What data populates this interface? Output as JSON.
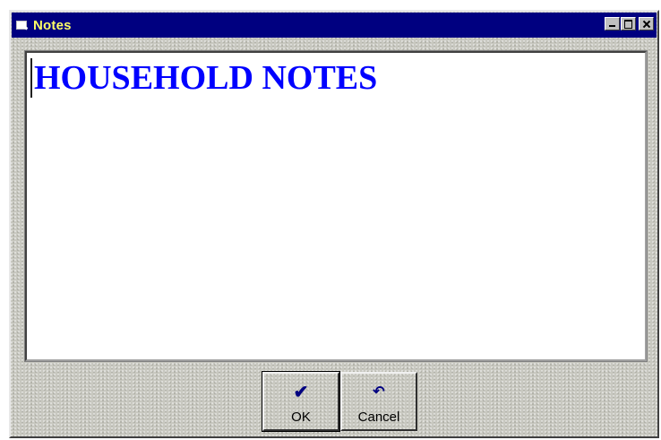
{
  "window": {
    "title": "Notes",
    "title_color": "#ffff66",
    "titlebar_color": "#000080",
    "icon": "notes-app-icon",
    "controls": [
      "minimize-icon",
      "maximize-icon",
      "close-icon"
    ]
  },
  "editor": {
    "text": "HOUSEHOLD NOTES",
    "text_color": "#0000ff",
    "background": "#ffffff"
  },
  "buttons": {
    "ok": {
      "label": "OK",
      "icon": "checkmark-icon",
      "glyph": "✔"
    },
    "cancel": {
      "label": "Cancel",
      "icon": "undo-arrow-icon",
      "glyph": "↶"
    }
  }
}
